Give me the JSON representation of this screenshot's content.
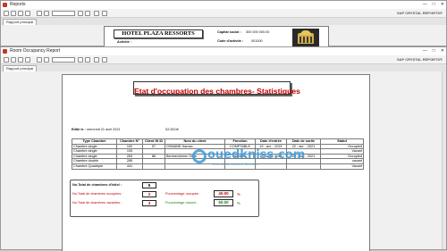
{
  "back_window": {
    "title": "Reports",
    "controls": [
      "—",
      "□",
      "✕"
    ],
    "logo": "SAP CRYSTAL REPORTS®",
    "tab": "Rapport principal",
    "hotel_name": "HOTEL PLAZA RESSORTS",
    "activite_label": "Activité :",
    "capital_label": "Capital social :",
    "capital_value": "300 000 000.00",
    "code_label": "Code d'activité :",
    "code_value": "001000"
  },
  "front_window": {
    "title": "Room Occupancy Report",
    "controls": [
      "—",
      "□",
      "✕"
    ],
    "logo": "SAP CRYSTAL REPORTS®",
    "tab": "Rapport principal"
  },
  "report": {
    "title": "Etat d'occupation des chambres- Statistiques",
    "date_label": "Edité le :",
    "date_value": "mercredi 21 avril 2021",
    "time_value": "02:28:06",
    "headers": [
      "Type Chambre",
      "Chambre N°",
      "Client IN ID",
      "Nom du client",
      "Fonction",
      "Date d'entrée",
      "Date de sortie",
      "Statut"
    ],
    "rows": [
      [
        "Chambre single",
        "192",
        "57",
        "OSMANE Hamza",
        "COMPTABLE",
        "19 - avr. - 2021",
        "22 - avr. - 2021",
        "Occupied"
      ],
      [
        "Chambre single",
        "193",
        "",
        "",
        "",
        "",
        "",
        "Vacant"
      ],
      [
        "Chambre single",
        "263",
        "86",
        "Benmechenen Taha",
        "Medecin",
        "19 - avr. - 2021",
        "22 - avr. - 2021",
        "Occupied"
      ],
      [
        "Chambre double",
        "265",
        "",
        "",
        "",
        "",
        "",
        "vacant"
      ],
      [
        "Chambre Quadriple",
        "441",
        "",
        "",
        "",
        "",
        "",
        "Vacant"
      ]
    ],
    "stats": {
      "total_label": "No.Total de chambres d'hôtel :",
      "total_value": "5",
      "occupied_label": "No.Total de chambres occupées :",
      "occupied_value": "2",
      "vacant_label": "No.Total de chambres vacantes :",
      "vacant_value": "3",
      "pct_occupied_label": "Pourcentage occupée :",
      "pct_occupied_value": "40.00",
      "pct_vacant_label": "Pourcentage vacant :",
      "pct_vacant_value": "60.00",
      "pct_sign": "%"
    }
  },
  "watermark": {
    "site": "ouedkniss.com",
    "tagline": "Vente, Achat, Location, Services..."
  },
  "colors": {
    "accent_red": "#c00000",
    "accent_green": "#1a7a1a",
    "watermark": "#3b9ad9"
  }
}
